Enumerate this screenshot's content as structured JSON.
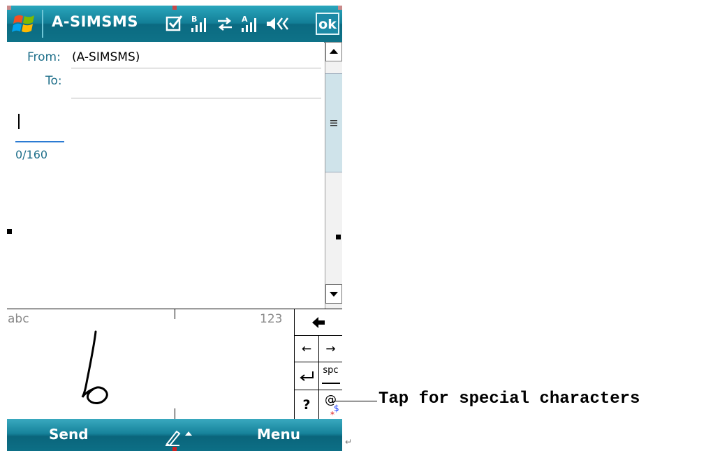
{
  "titlebar": {
    "app_title": "A-SIMSMS",
    "ok_label": "ok",
    "icons": [
      "windows-start-icon",
      "message-icon",
      "signal-b-icon",
      "sync-arrows-icon",
      "signal-a-icon",
      "speaker-icon"
    ],
    "signal_b_letter": "B",
    "signal_a_letter": "A"
  },
  "header": {
    "from_label": "From:",
    "from_value": "(A-SIMSMS)",
    "to_label": "To:",
    "to_value": ""
  },
  "body": {
    "text": "",
    "counter": "0/160"
  },
  "input_panel": {
    "mode_left": "abc",
    "mode_right": "123",
    "keys": {
      "backspace": "🡄",
      "left": "←",
      "right": "→",
      "enter": "↵",
      "space": "spc",
      "help": "?",
      "special": "@"
    }
  },
  "softkeys": {
    "left": "Send",
    "right": "Menu"
  },
  "callout": {
    "text": "Tap for special characters"
  },
  "colors": {
    "titlebar": "#137f97",
    "softbar": "#17839b",
    "field_label": "#1f6f8a",
    "counter_line": "#2b7bd3"
  }
}
